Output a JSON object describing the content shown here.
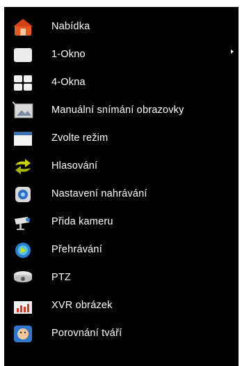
{
  "menu": {
    "items": [
      {
        "label": "Nabídka",
        "icon": "home-icon"
      },
      {
        "label": "1-Okno",
        "icon": "single-window-icon",
        "submenu": true
      },
      {
        "label": "4-Okna",
        "icon": "quad-window-icon"
      },
      {
        "label": "Manuální snímání obrazovky",
        "icon": "screenshot-icon"
      },
      {
        "label": "Zvolte režim",
        "icon": "mode-window-icon"
      },
      {
        "label": "Hlasování",
        "icon": "rotation-arrows-icon"
      },
      {
        "label": "Nastavení nahrávání",
        "icon": "record-settings-icon"
      },
      {
        "label": "Přida kameru",
        "icon": "camera-icon"
      },
      {
        "label": "Přehrávání",
        "icon": "playback-icon"
      },
      {
        "label": "PTZ",
        "icon": "ptz-camera-icon"
      },
      {
        "label": "XVR obrázek",
        "icon": "bar-chart-icon"
      },
      {
        "label": "Porovnání tváří",
        "icon": "face-compare-icon"
      }
    ]
  },
  "colors": {
    "background": "#000000",
    "text": "#ffffff",
    "home_orange": "#e8541c",
    "accent_blue": "#2a74c9",
    "accent_green": "#c6d400",
    "chart_red": "#d63a2c"
  }
}
